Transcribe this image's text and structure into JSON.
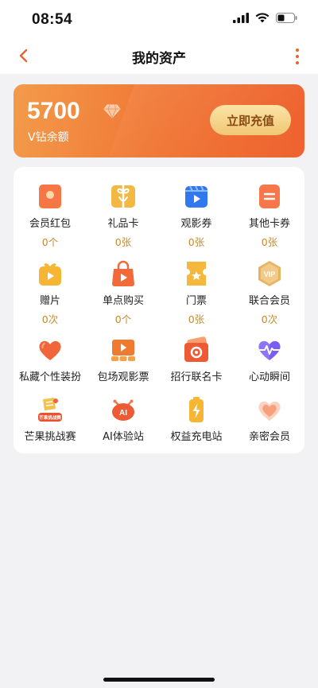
{
  "status_bar": {
    "time": "08:54"
  },
  "header": {
    "title": "我的资产"
  },
  "balance": {
    "amount": "5700",
    "label": "V钻余额",
    "recharge_label": "立即充值"
  },
  "assets": [
    {
      "label": "会员红包",
      "count": "0个",
      "icon": "red-envelope-icon"
    },
    {
      "label": "礼品卡",
      "count": "0张",
      "icon": "gift-card-icon"
    },
    {
      "label": "观影券",
      "count": "0张",
      "icon": "clapperboard-icon"
    },
    {
      "label": "其他卡券",
      "count": "0张",
      "icon": "coupon-icon"
    },
    {
      "label": "赠片",
      "count": "0次",
      "icon": "gift-box-icon"
    },
    {
      "label": "单点购买",
      "count": "0个",
      "icon": "shopping-bag-icon"
    },
    {
      "label": "门票",
      "count": "0张",
      "icon": "ticket-icon"
    },
    {
      "label": "联合会员",
      "count": "0次",
      "icon": "vip-badge-icon"
    },
    {
      "label": "私藏个性装扮",
      "icon": "heart-icon"
    },
    {
      "label": "包场观影票",
      "icon": "cinema-screen-icon"
    },
    {
      "label": "招行联名卡",
      "icon": "bank-card-icon"
    },
    {
      "label": "心动瞬间",
      "icon": "heartbeat-icon"
    },
    {
      "label": "芒果挑战赛",
      "icon": "challenge-trophy-icon",
      "badge_text": "芒果挑战赛"
    },
    {
      "label": "AI体验站",
      "icon": "ai-robot-icon",
      "badge_text": "AI"
    },
    {
      "label": "权益充电站",
      "icon": "battery-icon"
    },
    {
      "label": "亲密会员",
      "icon": "double-heart-icon"
    }
  ],
  "colors": {
    "accent": "#e9652c",
    "card_gradient_start": "#f39b4b",
    "card_gradient_end": "#ee6230",
    "count_text": "#c28b2e"
  }
}
